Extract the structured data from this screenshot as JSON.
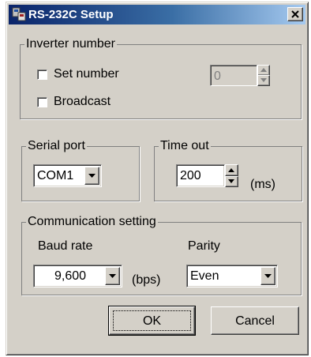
{
  "window": {
    "title": "RS-232C Setup",
    "close_label": "Close"
  },
  "inverter_number": {
    "legend": "Inverter number",
    "set_number_label": "Set number",
    "set_number_checked": false,
    "broadcast_label": "Broadcast",
    "broadcast_checked": false,
    "number_value": "0"
  },
  "serial_port": {
    "legend": "Serial port",
    "value": "COM1"
  },
  "time_out": {
    "legend": "Time out",
    "value": "200",
    "unit": "(ms)"
  },
  "communication": {
    "legend": "Communication setting",
    "baud_rate_label": "Baud rate",
    "baud_rate_value": "9,600",
    "baud_unit": "(bps)",
    "parity_label": "Parity",
    "parity_value": "Even"
  },
  "buttons": {
    "ok": "OK",
    "cancel": "Cancel"
  },
  "icons": {
    "app": "rs232c-app-icon",
    "close": "close-x-icon",
    "spin_up": "triangle-up-icon",
    "spin_down": "triangle-down-icon",
    "dropdown": "triangle-down-icon"
  },
  "colors": {
    "title_bar_start": "#0a246a",
    "title_bar_end": "#a6caf0",
    "dialog_face": "#d4d0c8"
  }
}
